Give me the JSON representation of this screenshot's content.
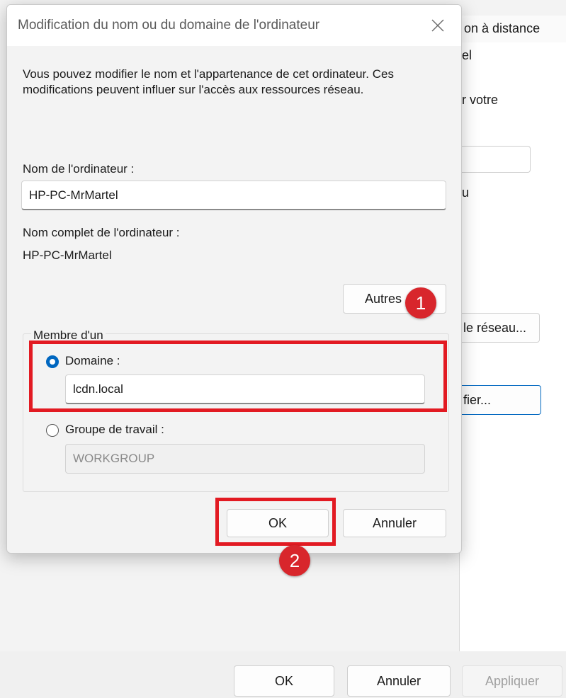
{
  "background_window": {
    "tab_label": "on à distance",
    "tab_sub": "el",
    "text_votre": "r votre",
    "text_u": "u",
    "network_button": "le réseau...",
    "modify_button": "fier...",
    "bottom_buttons": {
      "ok": "OK",
      "cancel": "Annuler",
      "apply": "Appliquer"
    }
  },
  "dialog": {
    "title": "Modification du nom ou du domaine de l'ordinateur",
    "description": "Vous pouvez modifier le nom et l'appartenance de cet ordinateur. Ces modifications peuvent influer sur l'accès aux ressources réseau.",
    "computer_name_label": "Nom de l'ordinateur :",
    "computer_name_value": "HP-PC-MrMartel",
    "full_name_label": "Nom complet de l'ordinateur :",
    "full_name_value": "HP-PC-MrMartel",
    "more_button": "Autres",
    "member_of_label": "Membre d'un",
    "domain_label": "Domaine :",
    "domain_value": "lcdn.local",
    "workgroup_label": "Groupe de travail :",
    "workgroup_value": "WORKGROUP",
    "ok_button": "OK",
    "cancel_button": "Annuler"
  },
  "annotations": {
    "badge_1": "1",
    "badge_2": "2",
    "color": "#e21a22"
  },
  "icons": {
    "close": "close-icon"
  }
}
